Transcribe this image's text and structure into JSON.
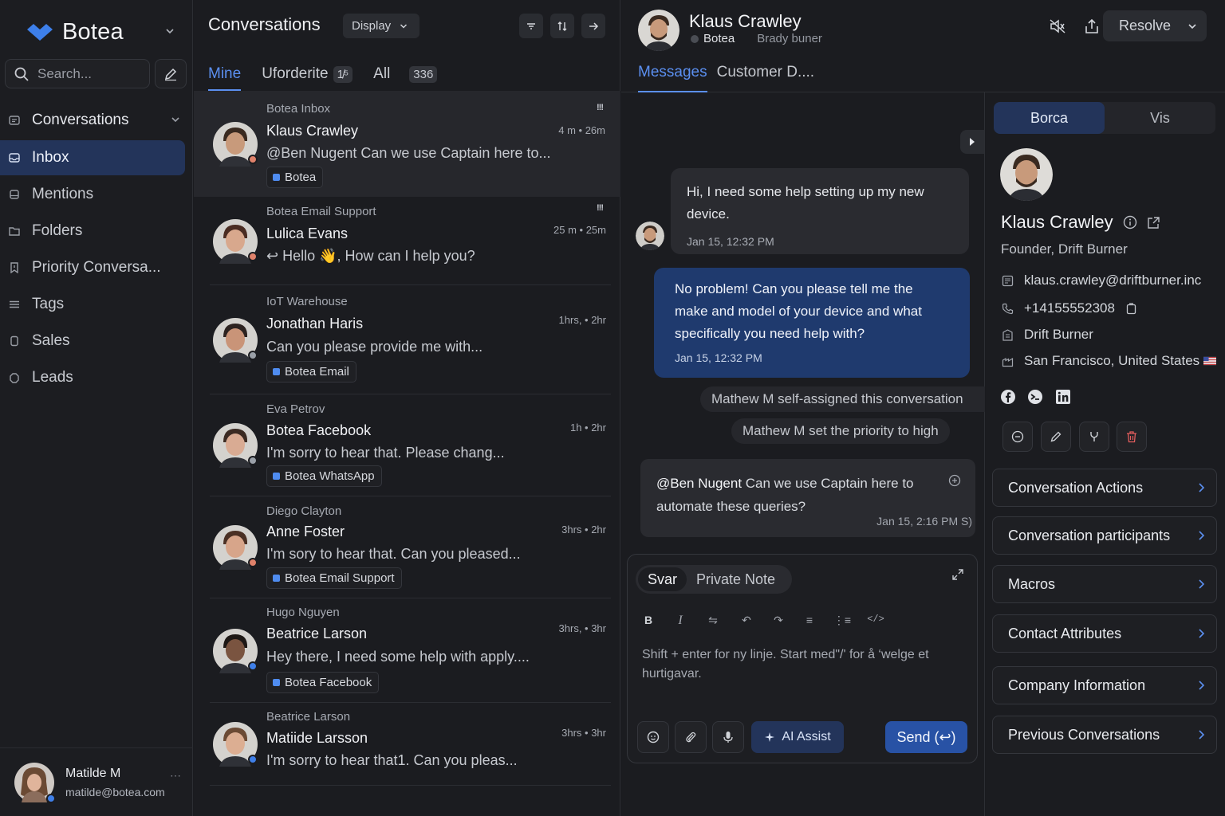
{
  "sidebar": {
    "brand": "Botea",
    "search_placeholder": "Search...",
    "items": [
      {
        "label": "Conversations",
        "icon": "conversations-icon"
      },
      {
        "label": "Inbox",
        "icon": "inbox-icon"
      },
      {
        "label": "Mentions",
        "icon": "mentions-icon"
      },
      {
        "label": "Folders",
        "icon": "folder-icon"
      },
      {
        "label": "Priority Conversa...",
        "icon": "priority-icon"
      },
      {
        "label": "Tags",
        "icon": "tags-icon"
      },
      {
        "label": "Sales",
        "icon": "sales-icon"
      },
      {
        "label": "Leads",
        "icon": "leads-icon"
      }
    ],
    "user": {
      "name": "Matilde M",
      "email": "matilde@botea.com"
    }
  },
  "list": {
    "title": "Conversations",
    "display_label": "Display",
    "tabs": [
      {
        "label": "Mine",
        "count": ""
      },
      {
        "label": "Uforderite",
        "count": "1̸⁵"
      },
      {
        "label": "All",
        "count": "336"
      }
    ],
    "rows": [
      {
        "inbox": "Botea Inbox",
        "name": "Klaus Crawley",
        "message": "@Ben Nugent Can we use Captain here to...",
        "time": "4 m • 26m",
        "tag": "Botea",
        "priority": "!!!",
        "skin": "#c89a7b",
        "hair": "#3a2a20",
        "badge": "#e0826b"
      },
      {
        "inbox": "Botea Email Support",
        "name": "Lulica Evans",
        "message": "↩ Hello 👋, How can I help you?",
        "time": "25 m • 25m",
        "tag": "",
        "priority": "!!!",
        "skin": "#d8a88d",
        "hair": "#4a2c22",
        "badge": "#e0826b"
      },
      {
        "inbox": "IoT Warehouse",
        "name": "Jonathan Haris",
        "message": "Can you please provide me with...",
        "time": "1hrs, • 2hr",
        "tag": "Botea Email",
        "priority": "",
        "skin": "#c99478",
        "hair": "#2d2320",
        "badge": "#9aa0a8"
      },
      {
        "inbox": "Eva Petrov",
        "name": "Botea Facebook",
        "message": "I'm sorry to hear that. Please chang...",
        "time": "1h • 2hr",
        "tag": "Botea WhatsApp",
        "priority": "",
        "skin": "#d9ab93",
        "hair": "#3b2a22",
        "badge": "#9aa0a8"
      },
      {
        "inbox": "Diego Clayton",
        "name": "Anne Foster",
        "message": "I'm sory to hear that. Can you pleased...",
        "time": "3hrs • 2hr",
        "tag": "Botea Email Support",
        "priority": "",
        "skin": "#d7a58a",
        "hair": "#4a3024",
        "badge": "#e0826b"
      },
      {
        "inbox": "Hugo Nguyen",
        "name": "Beatrice Larson",
        "message": "Hey there, I need some help with apply....",
        "time": "3hrs, • 3hr",
        "tag": "Botea Facebook",
        "priority": "",
        "skin": "#7a5440",
        "hair": "#1e1815",
        "badge": "#3f7fe8"
      },
      {
        "inbox": "Beatrice Larson",
        "name": "Matiide Larsson",
        "message": "I'm sorry to hear that1. Can you pleas...",
        "time": "3hrs • 3hr",
        "tag": "",
        "priority": "",
        "skin": "#dcae92",
        "hair": "#6b4a34",
        "badge": "#3f7fe8"
      }
    ]
  },
  "chat": {
    "contact_name": "Klaus Crawley",
    "inbox": "Botea",
    "secondary": "Brady buner",
    "resolve_label": "Resolve",
    "tabs": [
      "Messages",
      "Customer D...."
    ],
    "messages": [
      {
        "text": "Hi, I need some help setting up my new device.",
        "time": "Jan 15, 12:32 PM"
      },
      {
        "text": "No problem! Can you please tell me the make and model of your device and what specifically you need help with?",
        "time": "Jan 15, 12:32 PM"
      }
    ],
    "activities": [
      "Mathew M self-assigned this conversation",
      "Mathew M set the priority to high"
    ],
    "note": {
      "mention": "@Ben Nugent",
      "text": " Can we use Captain here to automate these queries?",
      "time": "Jan 15, 2:16 PM S)"
    },
    "composer": {
      "tab_reply": "Svar",
      "tab_note": "Private Note",
      "placeholder": "Shift + enter for ny linje. Start med\"/' for å ‘welge et hurtigavar.",
      "ai_label": "AI Assist",
      "send_label": "Send (↩)"
    }
  },
  "panel": {
    "tabs": [
      "Borca",
      "Vis"
    ],
    "name": "Klaus Crawley",
    "role": "Founder, Drift Burner",
    "email": "klaus.crawley@driftburner.inc",
    "phone": "+14155552308",
    "company": "Drift Burner",
    "location": "San Francisco, United States",
    "sections": [
      "Conversation Actions",
      "Conversation participants",
      "Macros",
      "Contact Attributes",
      "Company Information",
      "Previous Conversations"
    ]
  },
  "colors": {
    "accent": "#5b8ff0",
    "active_bg": "#23345a",
    "outgoing_bubble": "#1f3a6e",
    "send": "#2852a5"
  }
}
